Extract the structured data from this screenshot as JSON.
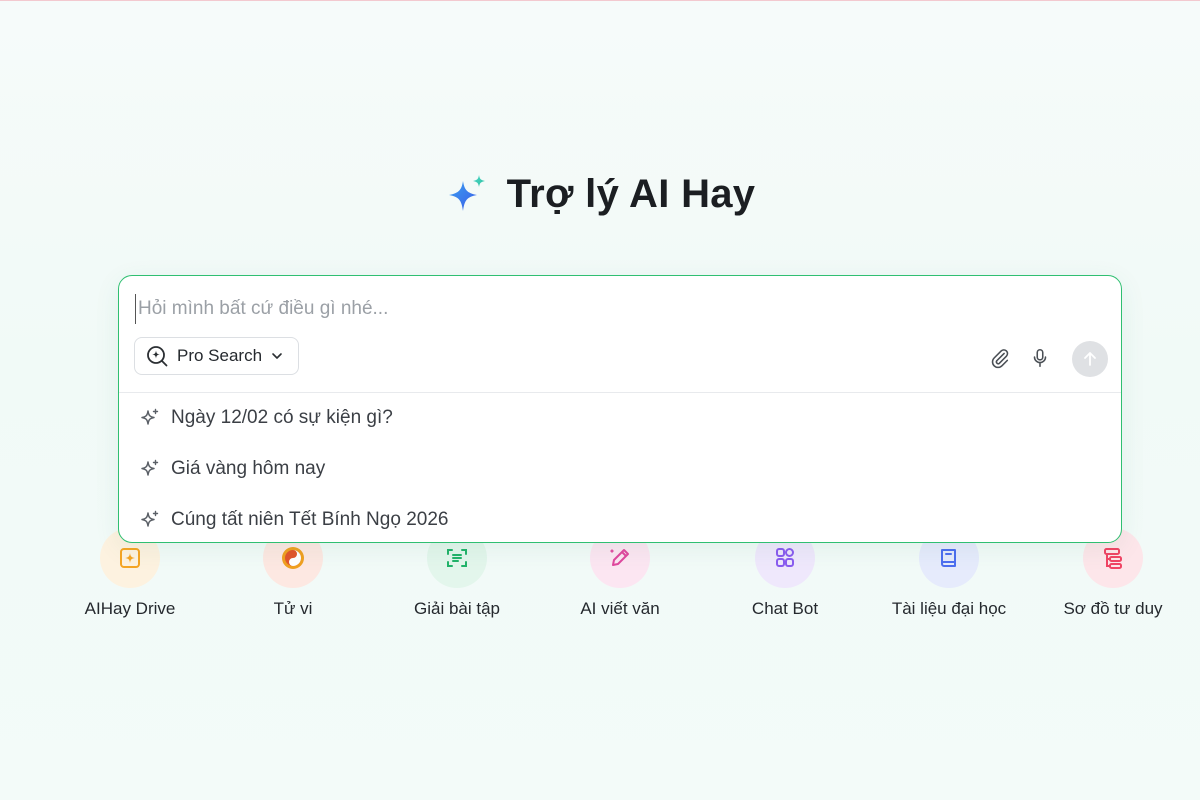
{
  "header": {
    "title": "Trợ lý AI Hay"
  },
  "search": {
    "placeholder": "Hỏi mình bất cứ điều gì nhé...",
    "mode_label": "Pro Search"
  },
  "suggestions": [
    "Ngày 12/02 có sự kiện gì?",
    "Giá vàng hôm nay",
    "Cúng tất niên Tết Bính Ngọ 2026"
  ],
  "tools": [
    {
      "label": "AIHay Drive",
      "icon": "drive-icon",
      "color": "#f5a524",
      "bg": "#fdf2e0"
    },
    {
      "label": "Tử vi",
      "icon": "yin-yang-icon",
      "color": "#e2552b",
      "bg": "#fde8e2"
    },
    {
      "label": "Giải bài tập",
      "icon": "scan-doc-icon",
      "color": "#22b36a",
      "bg": "#e3f6ec"
    },
    {
      "label": "AI viết văn",
      "icon": "pen-icon",
      "color": "#e0479e",
      "bg": "#fce6f2"
    },
    {
      "label": "Chat Bot",
      "icon": "grid-apps-icon",
      "color": "#8a5cf0",
      "bg": "#efe8fc"
    },
    {
      "label": "Tài liệu đại học",
      "icon": "book-icon",
      "color": "#4d6ef0",
      "bg": "#e6ebfc"
    },
    {
      "label": "Sơ đồ tư duy",
      "icon": "mindmap-icon",
      "color": "#f04464",
      "bg": "#fde6ea"
    }
  ],
  "colors": {
    "accent_border": "#2fbf71",
    "send_button_bg": "#dfe1e4"
  }
}
